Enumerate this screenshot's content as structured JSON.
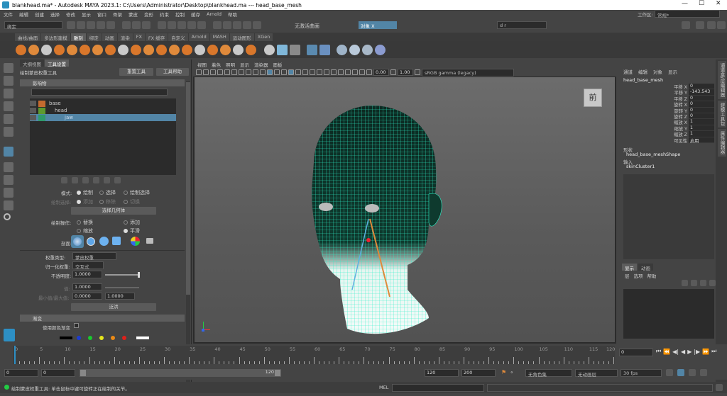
{
  "titlebar": {
    "title": "blankhead.ma* - Autodesk MAYA 2023.1: C:\\Users\\Administrator\\Desktop\\blankhead.ma  ---  head_base_mesh"
  },
  "menubar": [
    "文件",
    "编辑",
    "创建",
    "选择",
    "修改",
    "显示",
    "窗口",
    "骨架",
    "蒙皮",
    "变形",
    "约束",
    "控制",
    "缓存",
    "Arnold",
    "帮助"
  ],
  "workspace": {
    "label": "工作区:",
    "value": "常规*"
  },
  "statusline": {
    "mode": "绑定",
    "live": "无激活曲面",
    "object": "对象 X",
    "user": "d r"
  },
  "shelf_tabs": [
    "曲线/曲面",
    "多边形建模",
    "雕刻",
    "绑定",
    "动画",
    "渲染",
    "FX",
    "FX 缓存",
    "自定义",
    "Arnold",
    "MASH",
    "运动图形",
    "XGen"
  ],
  "shelf_active": "雕刻",
  "panel_tabs": {
    "outliner": "大纲视图",
    "tool": "工具设置"
  },
  "tool": {
    "title": "绘制蒙皮权重工具",
    "reset": "重置工具",
    "help": "工具帮助",
    "influence_header": "影响物",
    "influences": [
      {
        "name": "base",
        "indent": 0
      },
      {
        "name": "head",
        "indent": 1
      },
      {
        "name": "jaw",
        "indent": 2
      }
    ],
    "mode_label": "模式:",
    "mode_options": [
      "绘制",
      "选择",
      "绘制选择"
    ],
    "paint_select_label": "绘制选择:",
    "paint_select_options": [
      "添加",
      "移除",
      "切换"
    ],
    "select_geometry": "选择几何体",
    "paint_op_label": "绘制操作:",
    "paint_ops": [
      "替换",
      "添加",
      "缩放",
      "平滑"
    ],
    "profile_label": "剖面:",
    "weight_type_label": "权重类型:",
    "weight_type": "蒙皮权重",
    "normalize_label": "归一化权重:",
    "normalize": "交互式",
    "opacity_label": "不透明度:",
    "opacity": "1.0000",
    "value_label": "值:",
    "value": "1.0000",
    "minmax_label": "最小值/最大值:",
    "min": "0.0000",
    "max": "1.0000",
    "flood": "泛洪",
    "gradient_section": "渐变",
    "use_color_ramp": "使用颜色渐变"
  },
  "viewport": {
    "menu": [
      "视图",
      "着色",
      "照明",
      "显示",
      "渲染器",
      "面板"
    ],
    "exposure": "0.00",
    "gamma": "1.00",
    "colorspace": "sRGB gamma (legacy)",
    "cube_label": "前"
  },
  "channelbox": {
    "tabs": [
      "通道",
      "编辑",
      "对象",
      "显示"
    ],
    "object_name": "head_base_mesh",
    "attributes": [
      {
        "name": "平移 X",
        "value": "0"
      },
      {
        "name": "平移 Y",
        "value": "-143.543"
      },
      {
        "name": "平移 Z",
        "value": "0"
      },
      {
        "name": "旋转 X",
        "value": "0"
      },
      {
        "name": "旋转 Y",
        "value": "0"
      },
      {
        "name": "旋转 Z",
        "value": "0"
      },
      {
        "name": "缩放 X",
        "value": "1"
      },
      {
        "name": "缩放 Y",
        "value": "1"
      },
      {
        "name": "缩放 Z",
        "value": "1"
      },
      {
        "name": "可见性",
        "value": "启用"
      }
    ],
    "shapes_label": "形状",
    "shape_name": "head_base_meshShape",
    "inputs_label": "输入",
    "input_name": "skinCluster1",
    "layer_tabs": [
      "显示",
      "动画"
    ],
    "layer_menu": [
      "层",
      "选项",
      "帮助"
    ]
  },
  "side_tabs": [
    "通道盒/层编辑器",
    "建模工具包",
    "属性编辑器"
  ],
  "timeline": {
    "ticks": [
      0,
      5,
      10,
      15,
      20,
      25,
      30,
      35,
      40,
      45,
      50,
      55,
      60,
      65,
      70,
      75,
      80,
      85,
      90,
      95,
      100,
      105,
      110,
      115,
      120
    ],
    "current_frame": "0"
  },
  "range": {
    "start": "0",
    "inner_start": "0",
    "slider_value": "120",
    "end": "120",
    "outer_end": "200",
    "character_set": "无角色集",
    "anim_layer": "无动画层",
    "fps": "30 fps"
  },
  "help": {
    "text": "绘制蒙皮权重工具: 单击鼠标中键可旋转正在绘制的关节。",
    "mel": "MEL"
  },
  "colors": {
    "accent": "#5285a6",
    "wire": "#2ef0c8",
    "swatches": [
      "#000000",
      "#1c3ccf",
      "#19c92f",
      "#e6e61c",
      "#ea8a16",
      "#e0201a",
      "#ffffff"
    ]
  }
}
